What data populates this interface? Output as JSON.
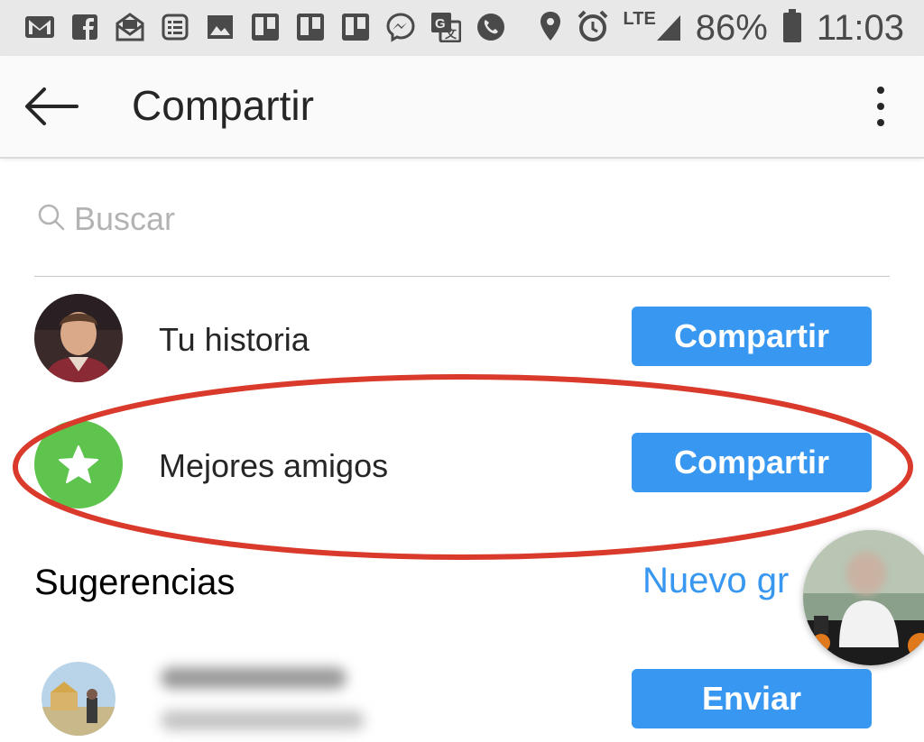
{
  "status_bar": {
    "battery": "86%",
    "time": "11:03",
    "network": "LTE",
    "icons": [
      "gmail-icon",
      "facebook-icon",
      "mail-stack-icon",
      "news-icon",
      "gallery-icon",
      "trello-icon",
      "trello-icon",
      "trello-icon",
      "messenger-icon",
      "translate-icon",
      "phone-icon"
    ]
  },
  "header": {
    "title": "Compartir",
    "back_icon": "arrow-left-icon",
    "menu_icon": "more-vertical-icon"
  },
  "search": {
    "placeholder": "Buscar",
    "value": ""
  },
  "share_targets": [
    {
      "label": "Tu historia",
      "button": "Compartir"
    },
    {
      "label": "Mejores amigos",
      "button": "Compartir",
      "icon": "star-icon"
    }
  ],
  "suggestions": {
    "title": "Sugerencias",
    "new_group": "Nuevo gr",
    "first_button": "Enviar"
  },
  "colors": {
    "accent": "#3897f0",
    "close_friends_green": "#5ec44e",
    "annotation_red": "#d93a2b"
  }
}
